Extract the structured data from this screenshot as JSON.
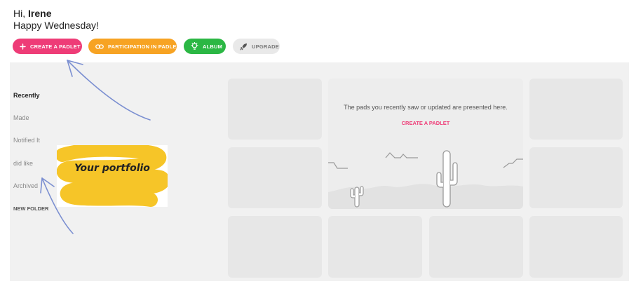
{
  "greeting": {
    "hi": "Hi,",
    "name": "Irene",
    "day": "Happy Wednesday!"
  },
  "toolbar": {
    "create_label": "CREATE A PADLET",
    "participation_label": "PARTICIPATION IN PADLET",
    "album_label": "ALBUM",
    "upgrade_label": "UPGRADE"
  },
  "sidebar": {
    "items": [
      {
        "label": "Recently"
      },
      {
        "label": "Made"
      },
      {
        "label": "Notified It"
      },
      {
        "label": "did like"
      },
      {
        "label": "Archived"
      }
    ],
    "new_folder": "NEW FOLDER"
  },
  "empty_state": {
    "message": "The pads you recently saw or updated are presented here.",
    "cta": "CREATE A PADLET"
  },
  "annotation": {
    "label": "Your portfolio"
  },
  "colors": {
    "pink": "#ee3c77",
    "orange": "#f7a323",
    "green": "#2bb744",
    "arrow": "#7b8fd1",
    "highlight": "#f6c21c"
  }
}
